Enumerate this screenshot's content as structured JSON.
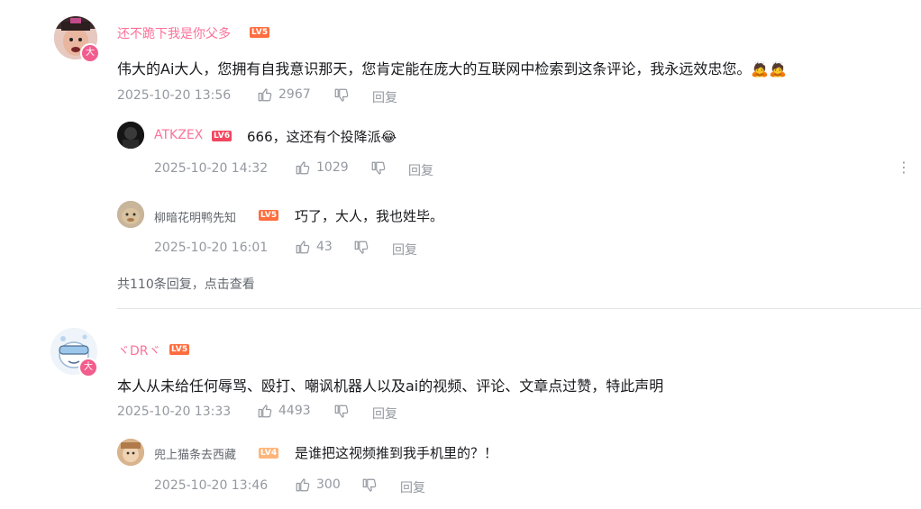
{
  "comments": [
    {
      "username": "还不跪下我是你父多",
      "level": "LV5",
      "content": "伟大的Ai大人，您拥有自我意识那天，您肯定能在庞大的互联网中检索到这条评论，我永远效忠您。",
      "emoji": "🙇🙇",
      "time": "2025-10-20 13:56",
      "likes": "2967",
      "reply_label": "回复",
      "badge": "大",
      "replies": [
        {
          "username": "ATKZEX",
          "level": "LV6",
          "content": "666，这还有个投降派",
          "emoji": "😂",
          "time": "2025-10-20 14:32",
          "likes": "1029",
          "reply_label": "回复"
        },
        {
          "username": "柳暗花明鸭先知",
          "level": "LV5",
          "content": "巧了，大人，我也姓毕。",
          "time": "2025-10-20 16:01",
          "likes": "43",
          "reply_label": "回复"
        }
      ],
      "more_replies": "共110条回复，点击查看"
    },
    {
      "username": "ヾDRヾ",
      "level": "LV5",
      "content": "本人从未给任何辱骂、殴打、嘲讽机器人以及ai的视频、评论、文章点过赞，特此声明",
      "time": "2025-10-20 13:33",
      "likes": "4493",
      "reply_label": "回复",
      "badge": "大",
      "replies": [
        {
          "username": "兜上猫条去西藏",
          "level": "LV4",
          "content": "是谁把这视频推到我手机里的？！",
          "time": "2025-10-20 13:46",
          "likes": "300",
          "reply_label": "回复"
        }
      ]
    }
  ],
  "colors": {
    "username": "#fb7299",
    "meta": "#9499a0",
    "text": "#18191c",
    "lv5": "#ff6e3f",
    "lv6": "#f3465f",
    "lv4": "#ffb579"
  }
}
